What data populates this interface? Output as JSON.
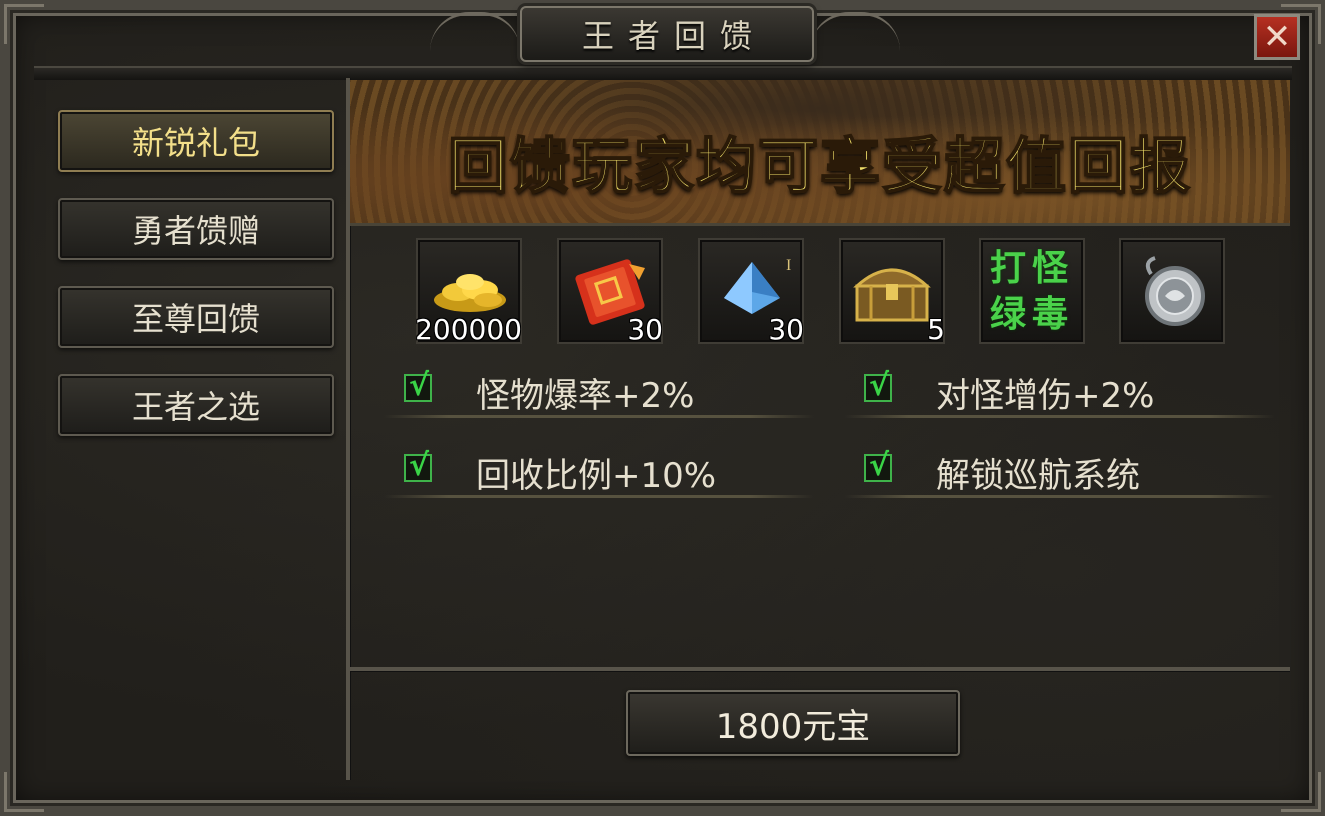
{
  "window": {
    "title": "王者回馈",
    "close_symbol": "✕"
  },
  "sidebar": {
    "tabs": [
      {
        "label": "新锐礼包",
        "active": true
      },
      {
        "label": "勇者馈赠",
        "active": false
      },
      {
        "label": "至尊回馈",
        "active": false
      },
      {
        "label": "王者之选",
        "active": false
      }
    ]
  },
  "banner": {
    "text": "回馈玩家均可享受超值回报"
  },
  "rewards": [
    {
      "icon": "gold-coins-icon",
      "qty": "200000"
    },
    {
      "icon": "red-scroll-icon",
      "qty": "30"
    },
    {
      "icon": "blue-crystal-icon",
      "qty": "30"
    },
    {
      "icon": "treasure-chest-icon",
      "qty": "5"
    },
    {
      "icon": "green-text-icon",
      "text": "打怪绿毒"
    },
    {
      "icon": "medal-icon"
    }
  ],
  "perks": [
    {
      "label": "怪物爆率+2%",
      "checked": true
    },
    {
      "label": "对怪增伤+2%",
      "checked": true
    },
    {
      "label": "回收比例+10%",
      "checked": true
    },
    {
      "label": "解锁巡航系统",
      "checked": true
    }
  ],
  "check_symbol": "√",
  "purchase": {
    "label": "1800元宝"
  },
  "colors": {
    "active_tab_text": "#f3df8a",
    "banner_text": "#f2e06a",
    "check_green": "#3ad447",
    "close_red": "#b63022"
  }
}
